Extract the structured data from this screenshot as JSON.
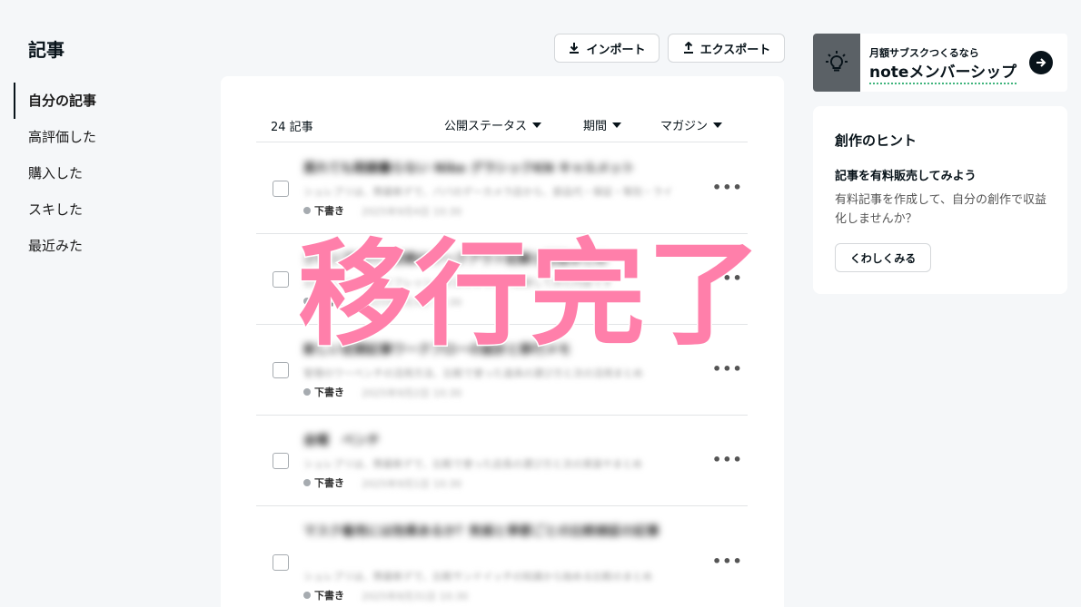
{
  "left": {
    "title": "記事",
    "nav": [
      "自分の記事",
      "高評価した",
      "購入した",
      "スキした",
      "最近みた"
    ]
  },
  "toolbar": {
    "import_label": "インポート",
    "export_label": "エクスポート"
  },
  "list": {
    "count": "24 記事",
    "filters": [
      "公開ステータス",
      "期間",
      "マガジン"
    ],
    "more_label": "•••",
    "rows": [
      {
        "title": "蒸れても眼鏡曇らない Nike グラシックKN キャルメット",
        "desc": "シュレブリは、際最新デで、ババのデーカメラ店から、部品代・保証・等別・ライ",
        "status": "下書き",
        "date": "2025年9月4日 10:30"
      },
      {
        "title": "ジャンプロバー初期のワークアウト記録と回復まとめ",
        "desc": "日常のフォームとリフレッシュ方法をまとめて記録してみた内容です",
        "status": "下書き",
        "date": "2025年9月3日 10:30"
      },
      {
        "title": "新しい定期記事ワークフローの設計と移行メモ",
        "desc": "管理のワーベンチの活用方法、比較で使った道具の選び方と次の活用まとめ",
        "status": "下書き",
        "date": "2025年9月2日 10:30"
      },
      {
        "title": "金曜　ベンチ",
        "desc": "シュレブリは、際最新デで、比較で使った店長の選び方と次の実装やまとめ",
        "status": "下書き",
        "date": "2025年9月1日 10:30"
      },
      {
        "title": "マスク着用には効果あるか？気候と季節ごとの比較検証の記事",
        "desc": "シュレブリは、際最新デで、比較サンドイッチの知識から始める比較のまとめ",
        "status": "下書き",
        "date": "2025年8月31日 10:30"
      }
    ]
  },
  "overlay": {
    "text": "移行完了"
  },
  "banner": {
    "small": "月額サブスクつくるなら",
    "big": "noteメンバーシップ"
  },
  "hint": {
    "title": "創作のヒント",
    "subtitle": "記事を有料販売してみよう",
    "body": "有料記事を作成して、自分の創作で収益化しませんか？",
    "button": "くわしくみる"
  },
  "colors": {
    "overlay": "#ff7faa",
    "accent_underline": "#3fb47c",
    "banner_icon_bg": "#5b6166"
  },
  "icons": [
    "download-icon",
    "upload-icon",
    "lightbulb-icon",
    "arrow-right-icon",
    "caret-down-icon",
    "more-icon"
  ]
}
